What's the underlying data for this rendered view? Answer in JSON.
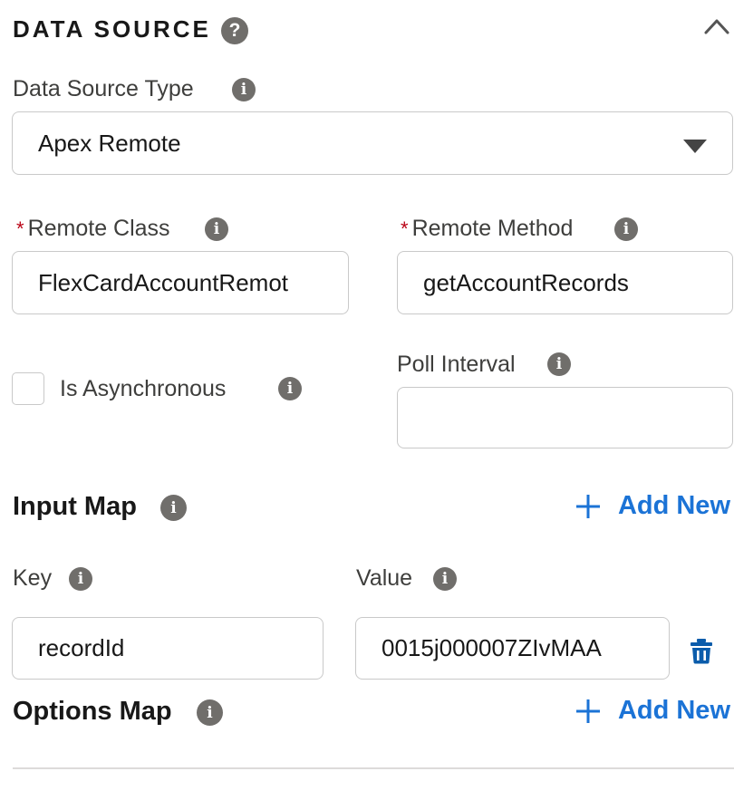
{
  "section": {
    "title": "DATA SOURCE",
    "help_icon": "question-icon",
    "collapse_icon": "chevron-up-icon"
  },
  "data_source_type": {
    "label": "Data Source Type",
    "value": "Apex Remote"
  },
  "remote_class": {
    "label": "Remote Class",
    "required_marker": "*",
    "value": "FlexCardAccountRemot"
  },
  "remote_method": {
    "label": "Remote Method",
    "required_marker": "*",
    "value": "getAccountRecords"
  },
  "is_asynchronous": {
    "label": "Is Asynchronous",
    "checked": false
  },
  "poll_interval": {
    "label": "Poll Interval",
    "value": ""
  },
  "input_map": {
    "title": "Input Map",
    "add_label": "Add New",
    "key_label": "Key",
    "value_label": "Value",
    "rows": [
      {
        "key": "recordId",
        "value": "0015j000007ZIvMAA"
      }
    ]
  },
  "options_map": {
    "title": "Options Map",
    "add_label": "Add New"
  },
  "info_glyph": "i",
  "help_glyph": "?",
  "colors": {
    "accent": "#1b73d6",
    "required": "#ba0517",
    "icon_gray": "#706e6b",
    "delete_icon": "#0b5cab"
  }
}
